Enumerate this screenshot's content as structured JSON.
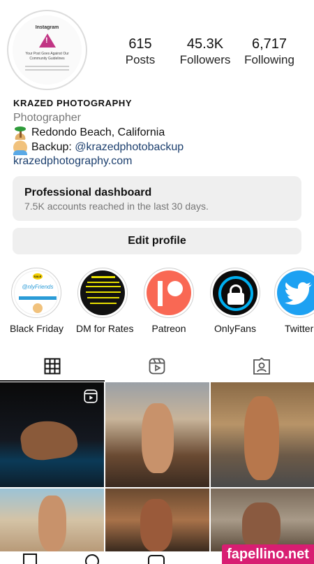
{
  "profile": {
    "stats": [
      {
        "value": "615",
        "label": "Posts"
      },
      {
        "value": "45.3K",
        "label": "Followers"
      },
      {
        "value": "6,717",
        "label": "Following"
      }
    ],
    "avatar_brand": "Instagram",
    "avatar_message": "Your Post Goes Against Our Community Guidelines",
    "name": "KRAZED PHOTOGRAPHY",
    "category": "Photographer",
    "location": "Redondo Beach, California",
    "backup_prefix": "Backup: ",
    "backup_handle": "@krazedphotobackup",
    "website": "krazedphotography.com"
  },
  "dashboard": {
    "title": "Professional dashboard",
    "subtitle": "7.5K accounts reached in the last 30 days."
  },
  "edit_profile_label": "Edit profile",
  "highlights": [
    {
      "label": "Black Friday",
      "icon": "onlyfriends-icon",
      "badge": "SALE",
      "text": "@nlyFriends"
    },
    {
      "label": "DM for Rates",
      "icon": "rates-flyer-icon"
    },
    {
      "label": "Patreon",
      "icon": "patreon-icon"
    },
    {
      "label": "OnlyFans",
      "icon": "lock-icon"
    },
    {
      "label": "Twitter",
      "icon": "twitter-icon"
    }
  ],
  "tabs": [
    "grid-icon",
    "reels-icon",
    "tagged-icon"
  ],
  "watermark": "fapellino.net",
  "colors": {
    "link": "#1c3f6e",
    "patreon": "#f96854",
    "onlyfans": "#00aff0",
    "twitter": "#1da1f2",
    "watermark": "#d81e72"
  }
}
